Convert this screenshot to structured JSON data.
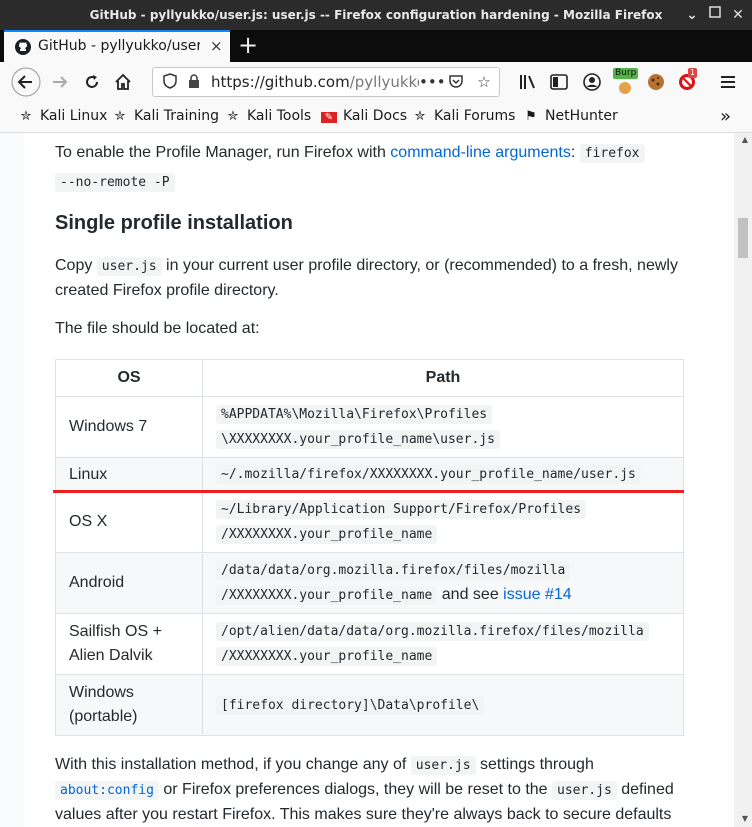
{
  "window": {
    "title": "GitHub - pyllyukko/user.js: user.js -- Firefox configuration hardening - Mozilla Firefox"
  },
  "tab": {
    "title": "GitHub - pyllyukko/user.js: user.js -- Firefox configuration hardening",
    "close": "×",
    "new_tab": "+"
  },
  "navbar": {
    "url_prefix": "https://",
    "url_host": "github.com",
    "url_path": "/pyllyukko/user.js"
  },
  "bookmarks": [
    {
      "label": "Kali Linux",
      "icon": "kali-dragon-icon"
    },
    {
      "label": "Kali Training",
      "icon": "kali-dragon-icon"
    },
    {
      "label": "Kali Tools",
      "icon": "kali-dragon-icon"
    },
    {
      "label": "Kali Docs",
      "icon": "kali-docs-icon"
    },
    {
      "label": "Kali Forums",
      "icon": "kali-dragon-icon"
    },
    {
      "label": "NetHunter",
      "icon": "nethunter-icon"
    }
  ],
  "extensions": {
    "burp_label": "Burp",
    "badge_count": "1"
  },
  "content": {
    "p1_text": "To enable the Profile Manager, run Firefox with ",
    "p1_link": "command-line arguments",
    "p1_sep": ": ",
    "p1_code_line1": "firefox",
    "p1_code_line2": "--no-remote -P",
    "heading": "Single profile installation",
    "p2_copy": "Copy ",
    "p2_code": "user.js",
    "p2_rest1": " in your current user profile directory, or (recommended) to a fresh, newly",
    "p2_rest2": "created Firefox profile directory.",
    "p3": "The file should be located at:",
    "table": {
      "headers": [
        "OS",
        "Path"
      ],
      "rows": [
        {
          "os": "Windows 7",
          "path1": "%APPDATA%\\Mozilla\\Firefox\\Profiles",
          "path2": "\\XXXXXXXX.your_profile_name\\user.js"
        },
        {
          "os": "Linux",
          "path1": "~/.mozilla/firefox/XXXXXXXX.your_profile_name/user.js",
          "path2": ""
        },
        {
          "os": "OS X",
          "path1": "~/Library/Application Support/Firefox/Profiles",
          "path2": "/XXXXXXXX.your_profile_name"
        },
        {
          "os": "Android",
          "path1": "/data/data/org.mozilla.firefox/files/mozilla",
          "path2": "/XXXXXXXX.your_profile_name",
          "suffix": " and see ",
          "link": "issue #14"
        },
        {
          "os1": "Sailfish OS +",
          "os2": "Alien Dalvik",
          "path1": "/opt/alien/data/data/org.mozilla.firefox/files/mozilla",
          "path2": "/XXXXXXXX.your_profile_name"
        },
        {
          "os1": "Windows",
          "os2": "(portable)",
          "path1": "[firefox directory]\\Data\\profile\\"
        }
      ]
    },
    "p4_a": "With this installation method, if you change any of ",
    "p4_code1": "user.js",
    "p4_b": " settings through",
    "p4_code2": "about:config",
    "p4_c": " or Firefox preferences dialogs, they will be reset to the ",
    "p4_code3": "user.js",
    "p4_d": " defined",
    "p4_line3": "values after you restart Firefox. This makes sure they're always back to secure defaults"
  },
  "colors": {
    "link": "#0366d6",
    "highlight_line": "#ef1d1d",
    "tab_accent": "#0a84ff"
  }
}
